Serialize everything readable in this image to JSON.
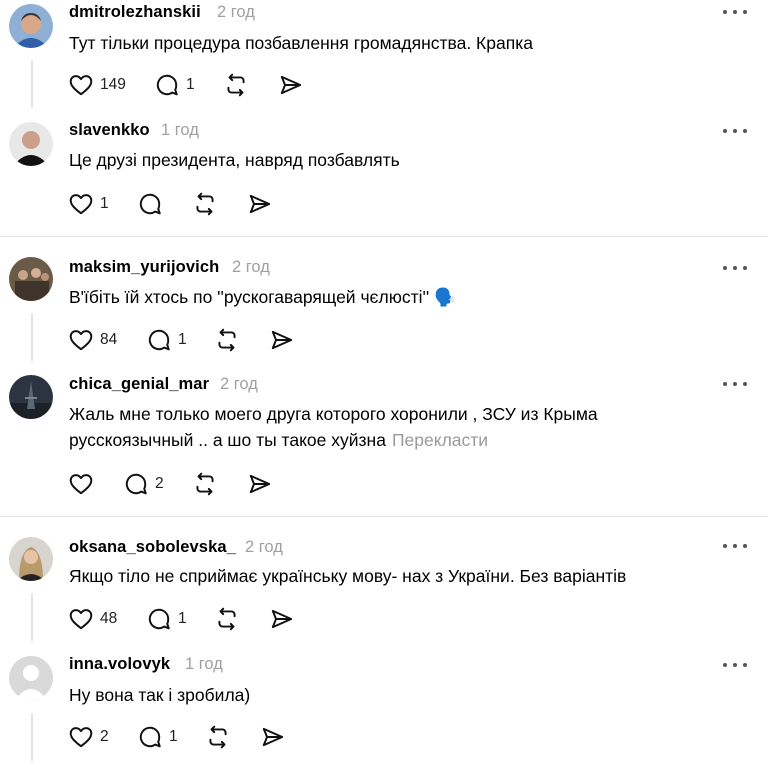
{
  "posts": [
    {
      "username": "dmitrolezhanskii",
      "time": "2 год",
      "text": "Тут тільки процедура позбавлення громадянства. Крапка",
      "likes": "149",
      "replies": "1",
      "avatar": "man-blue-shirt"
    },
    {
      "username": "slavenkko",
      "time": "1 год",
      "text": "Це друзі президента, навряд позбавлять",
      "likes": "1",
      "replies": "",
      "avatar": "man-bald"
    },
    {
      "username": "maksim_yurijovich",
      "time": "2 год",
      "text": "В'їбіть їй хтось по ''рускогаварящей чєлюсті'' 🗣️",
      "likes": "84",
      "replies": "1",
      "avatar": "group-photo"
    },
    {
      "username": "chica_genial_mar",
      "time": "2 год",
      "text": "Жаль мне только моего друга которого хоронили , ЗСУ из Крыма русскоязычный .. а шо ты такое хуйзна",
      "translate": "Перекласти",
      "likes": "",
      "replies": "2",
      "avatar": "eiffel-tower"
    },
    {
      "username": "oksana_sobolevska_",
      "time": "2 год",
      "text": "Якщо тіло не сприймає українську мову- нах з України. Без варіантів",
      "likes": "48",
      "replies": "1",
      "avatar": "woman-blonde"
    },
    {
      "username": "inna.volovyk",
      "time": "1 год",
      "text": "Ну вона так і зробила)",
      "likes": "2",
      "replies": "1",
      "avatar": "default-avatar"
    }
  ]
}
